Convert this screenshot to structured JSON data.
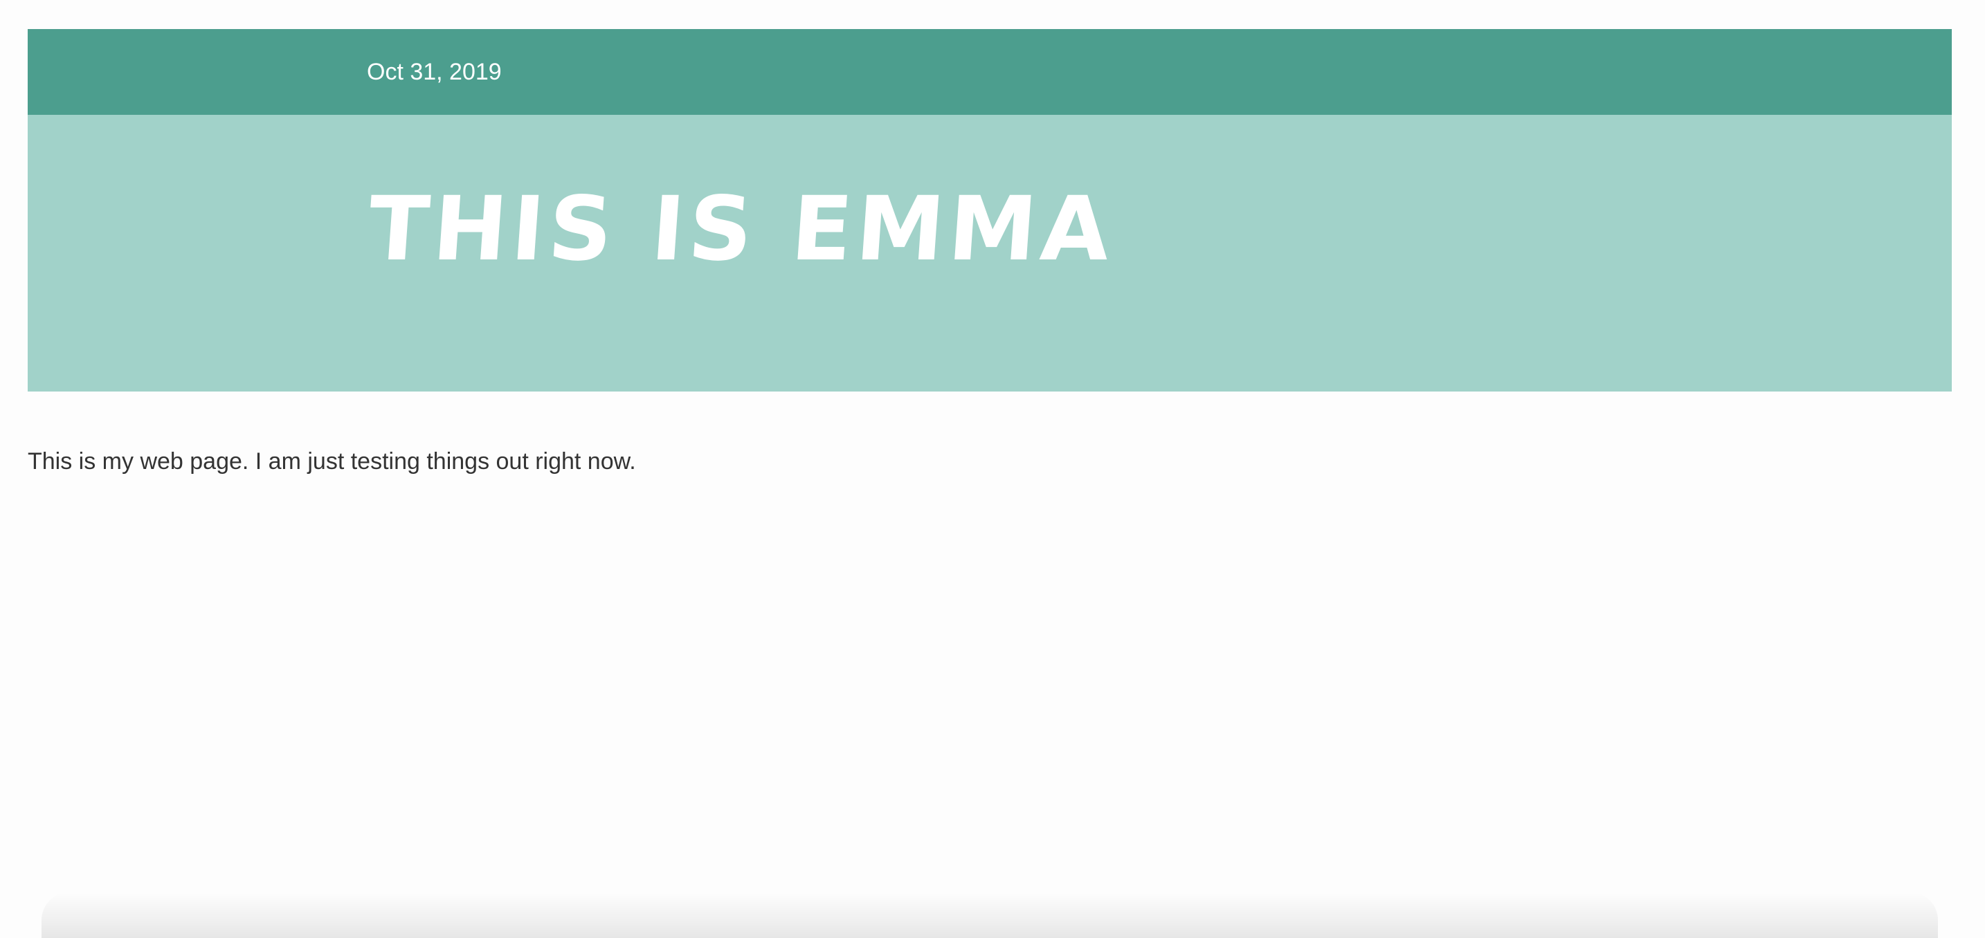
{
  "header": {
    "date": "Oct 31, 2019"
  },
  "hero": {
    "title": "THIS IS EMMA"
  },
  "content": {
    "intro": "This is my web page. I am just testing things out right now."
  },
  "colors": {
    "date_bar": "#4c9e8e",
    "hero_background": "#a1d2c9",
    "title_text": "#ffffff",
    "body_text": "#333333",
    "page_background": "#fdfdfd"
  }
}
